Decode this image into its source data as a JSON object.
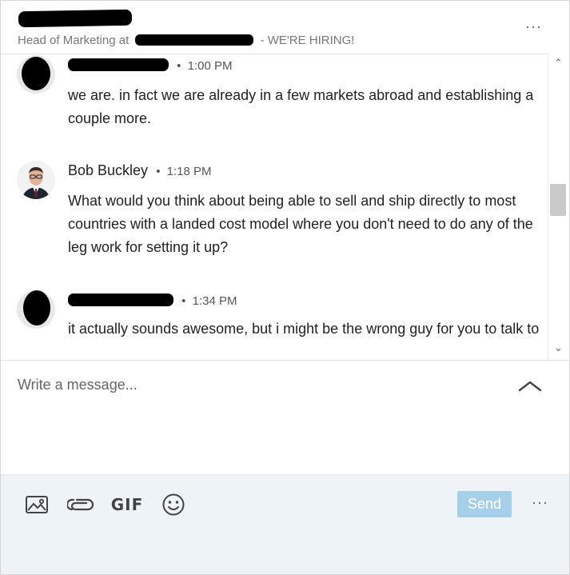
{
  "header": {
    "subtitle_prefix": "Head of Marketing at",
    "subtitle_suffix": "- WE'RE HIRING!",
    "more_icon": "···"
  },
  "messages": [
    {
      "time": "1:00 PM",
      "text": "we are. in fact we are already in a few markets abroad and establishing a couple more."
    },
    {
      "sender": "Bob Buckley",
      "time": "1:18 PM",
      "text": "What would you think about being able to sell and ship directly to most countries with a landed cost model where you don't need to do any of the leg work for setting it up?"
    },
    {
      "time": "1:34 PM",
      "text": "it actually sounds awesome, but i might be the wrong guy for you to talk to"
    }
  ],
  "compose": {
    "placeholder": "Write a message..."
  },
  "toolbar": {
    "gif_label": "GIF",
    "send_label": "Send",
    "more_icon": "···"
  },
  "colors": {
    "send_disabled": "#a6cfe9",
    "toolbar_bg": "#eef3f8"
  }
}
